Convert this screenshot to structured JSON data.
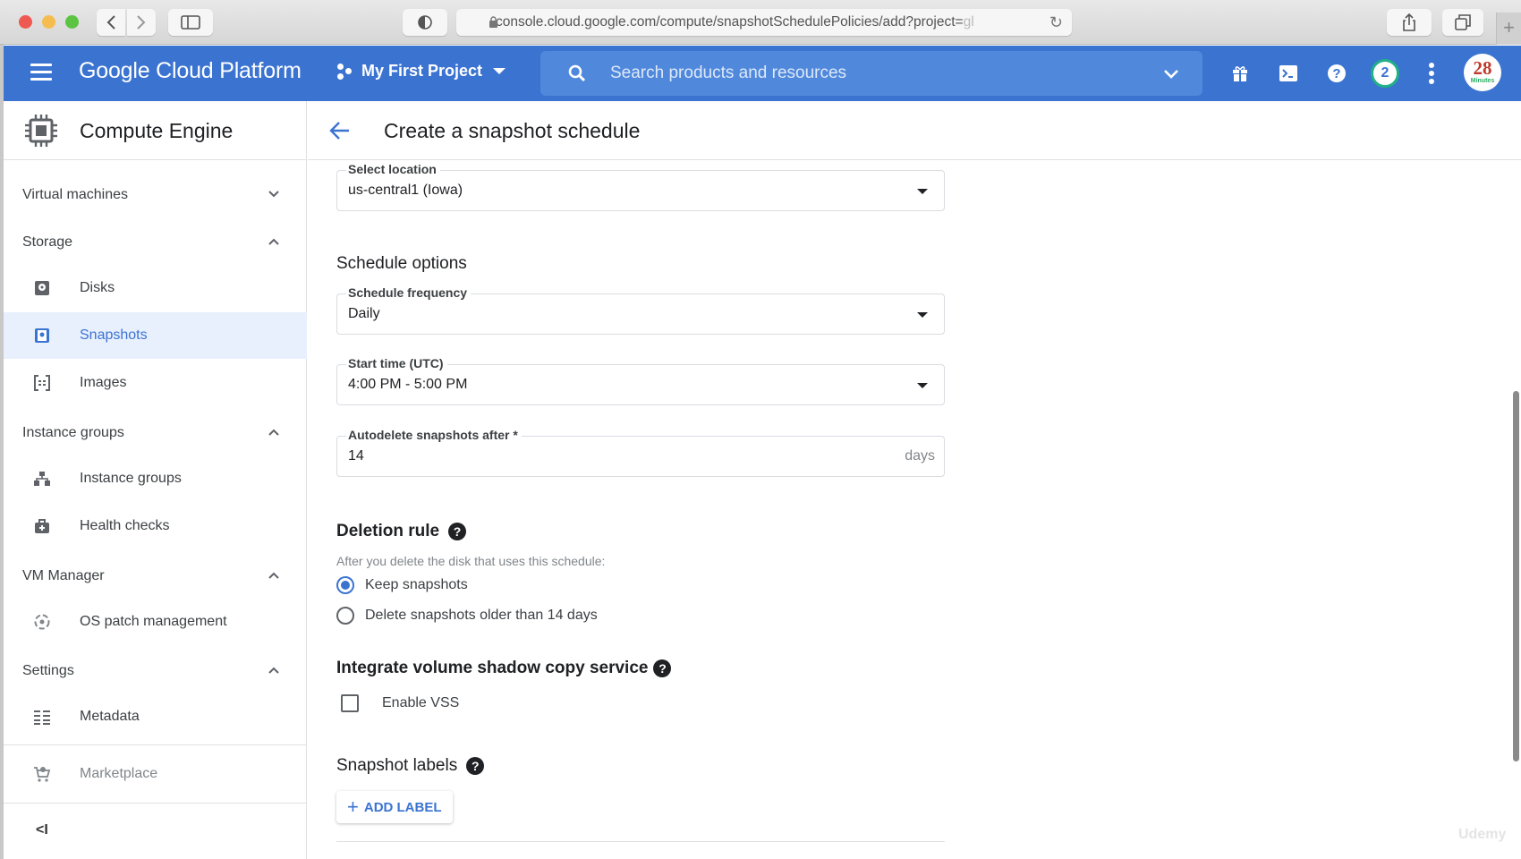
{
  "browser": {
    "url_main": "console.cloud.google.com/compute/snapshotSchedulePolicies/add?project=",
    "url_faded": "gl"
  },
  "topbar": {
    "brand": "Google Cloud Platform",
    "project": "My First Project",
    "search_placeholder": "Search products and resources",
    "notification_count": "2",
    "avatar_number": "28",
    "avatar_text": "Minutes",
    "brand_color": "#3b73d1"
  },
  "sidebar": {
    "product": "Compute Engine",
    "sections": [
      {
        "label": "Virtual machines",
        "expanded": false
      },
      {
        "label": "Storage",
        "expanded": true
      },
      {
        "label": "Instance groups",
        "expanded": true
      },
      {
        "label": "VM Manager",
        "expanded": true
      },
      {
        "label": "Settings",
        "expanded": true
      }
    ],
    "items": [
      {
        "label": "Disks",
        "icon": "disk-icon"
      },
      {
        "label": "Snapshots",
        "icon": "snapshot-icon",
        "active": true
      },
      {
        "label": "Images",
        "icon": "image-icon"
      },
      {
        "label": "Instance groups",
        "icon": "instance-groups-icon"
      },
      {
        "label": "Health checks",
        "icon": "health-check-icon"
      },
      {
        "label": "OS patch management",
        "icon": "patch-icon"
      },
      {
        "label": "Metadata",
        "icon": "metadata-icon"
      }
    ],
    "marketplace": "Marketplace",
    "collapse_label": "<I"
  },
  "main": {
    "title": "Create a snapshot schedule",
    "location": {
      "label": "Select location",
      "value": "us-central1 (Iowa)"
    },
    "schedule_options_title": "Schedule options",
    "frequency": {
      "label": "Schedule frequency",
      "value": "Daily"
    },
    "start_time": {
      "label": "Start time (UTC)",
      "value": "4:00 PM - 5:00 PM"
    },
    "autodelete": {
      "label": "Autodelete snapshots after *",
      "value": "14",
      "suffix": "days"
    },
    "deletion_rule": {
      "title": "Deletion rule",
      "hint": "After you delete the disk that uses this schedule:",
      "options": [
        {
          "label": "Keep snapshots",
          "checked": true
        },
        {
          "label": "Delete snapshots older than 14 days",
          "checked": false
        }
      ]
    },
    "vss": {
      "title": "Integrate volume shadow copy service",
      "checkbox_label": "Enable VSS",
      "checked": false
    },
    "labels": {
      "title": "Snapshot labels",
      "add_button": "ADD LABEL"
    },
    "help_glyph": "?"
  },
  "watermark": "Udemy"
}
